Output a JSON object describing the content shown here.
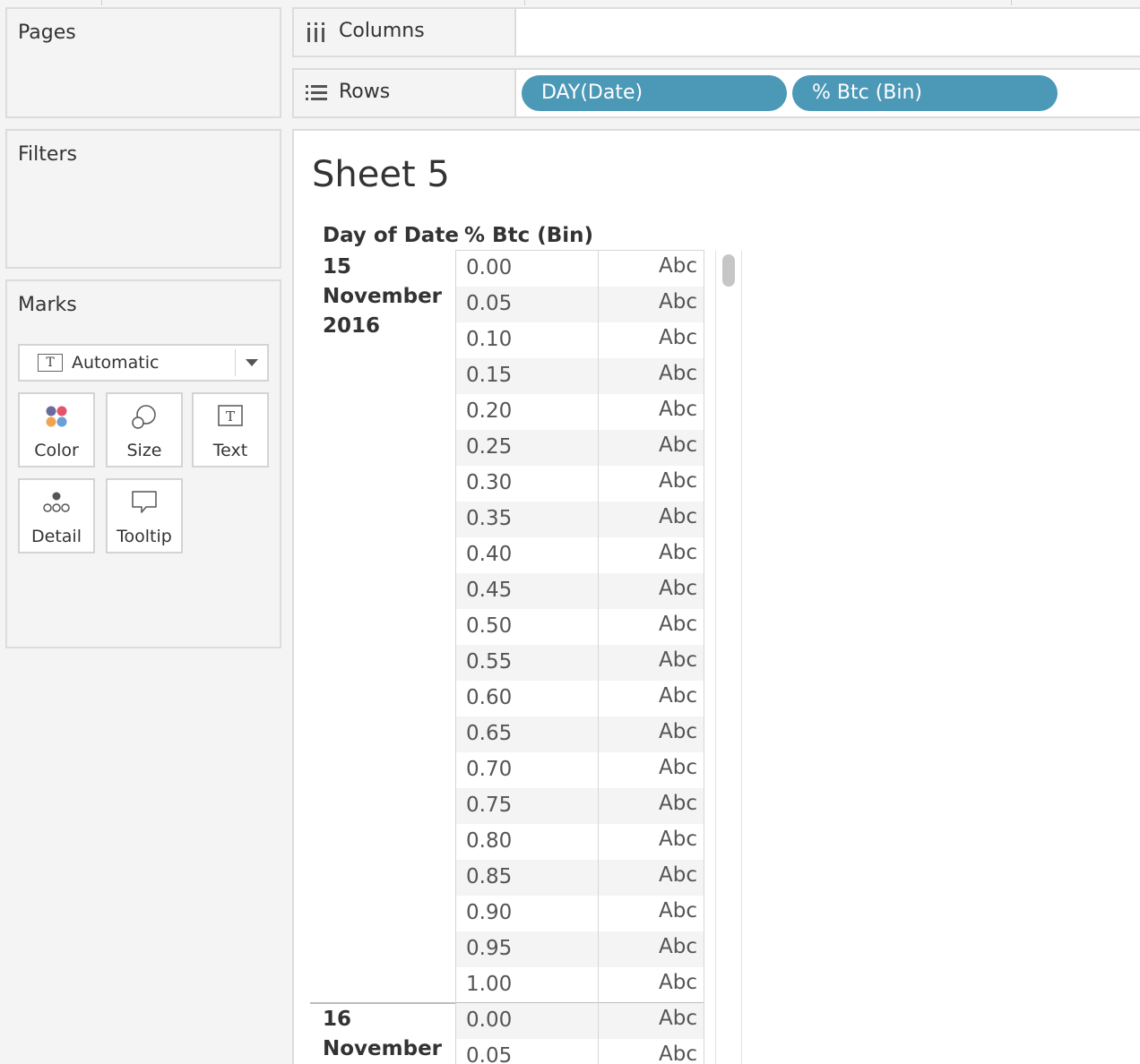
{
  "cards": {
    "pages_title": "Pages",
    "filters_title": "Filters",
    "marks_title": "Marks"
  },
  "marks": {
    "type_value": "Automatic",
    "type_icon": "text-t-icon",
    "buttons": [
      {
        "label": "Color",
        "icon": "color-dots-icon"
      },
      {
        "label": "Size",
        "icon": "size-circles-icon"
      },
      {
        "label": "Text",
        "icon": "text-t-icon"
      },
      {
        "label": "Detail",
        "icon": "detail-dots-icon"
      },
      {
        "label": "Tooltip",
        "icon": "speech-bubble-icon"
      }
    ]
  },
  "shelves": {
    "columns_label": "Columns",
    "rows_label": "Rows",
    "rows_pills": [
      "DAY(Date)",
      "% Btc (Bin)"
    ]
  },
  "view": {
    "sheet_title": "Sheet 5",
    "header_day": "Day of Date",
    "header_bin": "% Btc (Bin)",
    "mark_text": "Abc",
    "groups": [
      {
        "date_label": "15\nNovember\n2016",
        "bins": [
          "0.00",
          "0.05",
          "0.10",
          "0.15",
          "0.20",
          "0.25",
          "0.30",
          "0.35",
          "0.40",
          "0.45",
          "0.50",
          "0.55",
          "0.60",
          "0.65",
          "0.70",
          "0.75",
          "0.80",
          "0.85",
          "0.90",
          "0.95",
          "1.00"
        ]
      },
      {
        "date_label": "16\nNovember",
        "bins": [
          "0.00",
          "0.05"
        ]
      }
    ]
  },
  "colors": {
    "pill": "#4b98b7",
    "panel_bg": "#f4f4f4",
    "border": "#dcdcdc"
  }
}
